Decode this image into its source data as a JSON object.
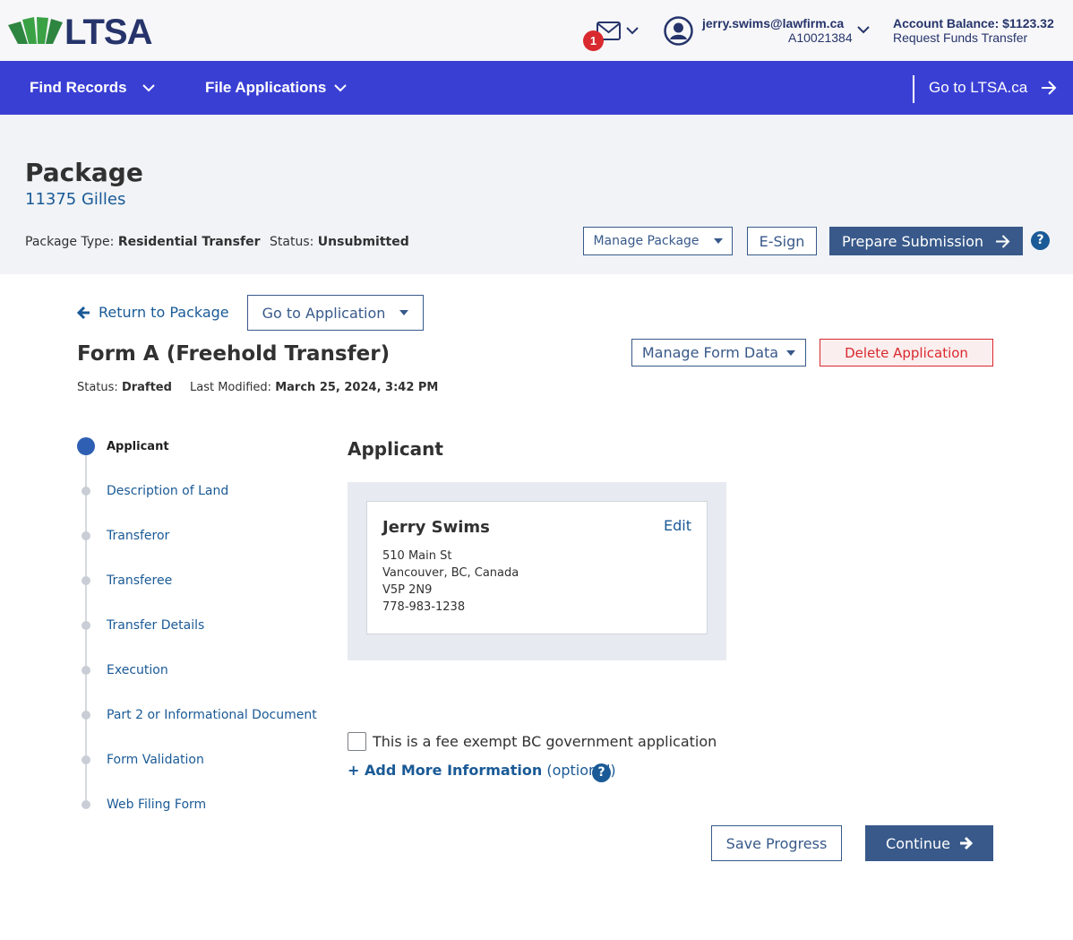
{
  "header": {
    "logo_text": "LTSA",
    "notification_count": "1",
    "user_email": "jerry.swims@lawfirm.ca",
    "user_account": "A10021384",
    "account_balance": "Account Balance: $1123.32",
    "funds_link": "Request Funds Transfer"
  },
  "nav": {
    "find_records": "Find Records",
    "file_applications": "File Applications",
    "go_to_ltsa": "Go to LTSA.ca"
  },
  "package": {
    "title": "Package",
    "name": "11375 Gilles",
    "type_label": "Package Type:",
    "type_value": "Residential Transfer",
    "status_label": "Status:",
    "status_value": "Unsubmitted",
    "manage_button": "Manage Package",
    "esign_button": "E-Sign",
    "prepare_button": "Prepare Submission",
    "help": "?"
  },
  "form": {
    "return_link": "Return to Package",
    "goto_app": "Go to Application",
    "title": "Form A (Freehold Transfer)",
    "status_label": "Status:",
    "status_value": "Drafted",
    "modified_label": "Last Modified:",
    "modified_value": "March 25, 2024, 3:42 PM",
    "manage_form_data": "Manage Form Data",
    "delete_app": "Delete Application"
  },
  "steps": [
    {
      "label": "Applicant",
      "active": true
    },
    {
      "label": "Description of Land",
      "active": false
    },
    {
      "label": "Transferor",
      "active": false
    },
    {
      "label": "Transferee",
      "active": false
    },
    {
      "label": "Transfer Details",
      "active": false
    },
    {
      "label": "Execution",
      "active": false
    },
    {
      "label": "Part 2 or Informational Document",
      "active": false
    },
    {
      "label": "Form Validation",
      "active": false
    },
    {
      "label": "Web Filing Form",
      "active": false
    }
  ],
  "applicant": {
    "section_title": "Applicant",
    "name": "Jerry Swims",
    "edit": "Edit",
    "address_line1": "510 Main St",
    "address_line2": "Vancouver, BC, Canada",
    "postal": "V5P 2N9",
    "phone": "778-983-1238"
  },
  "options": {
    "fee_exempt_label": "This is a fee exempt BC government application",
    "add_more": "+ Add More Information",
    "add_more_optional": "(optional)",
    "help": "?"
  },
  "actions": {
    "save": "Save Progress",
    "continue": "Continue"
  },
  "colors": {
    "nav_blue": "#3a3fd4",
    "primary": "#38598a",
    "link": "#1a5a96",
    "danger": "#d8292f",
    "logo_green": "#2e8540",
    "logo_navy": "#26346b"
  }
}
